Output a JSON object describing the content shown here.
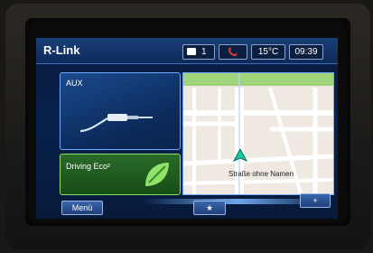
{
  "header": {
    "brand": "R-Link",
    "message_count": "1",
    "temperature": "15°C",
    "time": "09:39"
  },
  "tiles": {
    "aux_label": "AUX",
    "eco_label": "Driving Eco²"
  },
  "map": {
    "street_name": "Straße ohne Namen"
  },
  "bottom": {
    "menu_label": "Menü",
    "favorite_symbol": "★",
    "add_symbol": "+"
  },
  "icons": [
    "message-icon",
    "phone-icon",
    "aux-cable-icon",
    "eco-leaf-icon",
    "vehicle-position-icon"
  ],
  "colors": {
    "screen_blue": "#0a2450",
    "accent_blue": "#6fa6ff",
    "eco_green": "#8ee06b",
    "phone_red": "#d23b2d"
  }
}
